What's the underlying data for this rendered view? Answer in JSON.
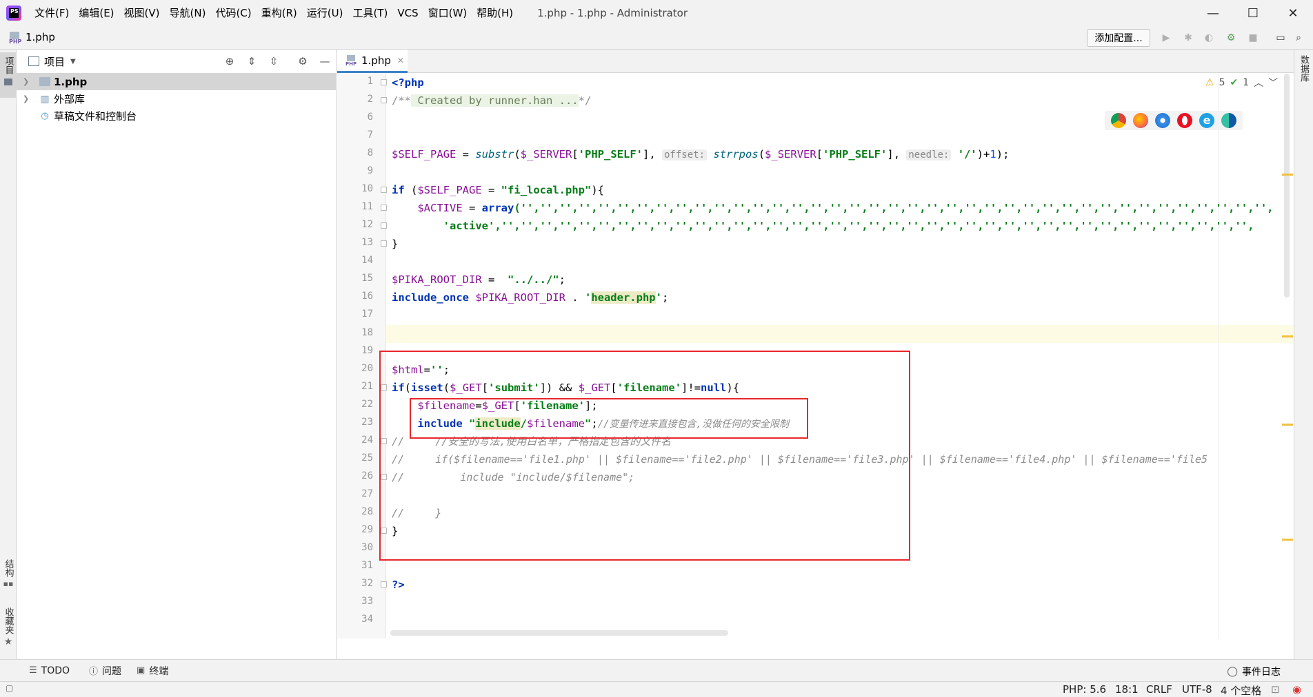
{
  "window": {
    "title": "1.php - 1.php - Administrator",
    "menu": [
      "文件(F)",
      "编辑(E)",
      "视图(V)",
      "导航(N)",
      "代码(C)",
      "重构(R)",
      "运行(U)",
      "工具(T)",
      "VCS",
      "窗口(W)",
      "帮助(H)"
    ],
    "minimize": "—",
    "maximize": "☐",
    "close": "✕"
  },
  "navbar": {
    "file_name": "1.php",
    "add_config": "添加配置..."
  },
  "left_strip": {
    "project": "项目",
    "structure": "结构",
    "favorites": "收藏夹"
  },
  "project_panel": {
    "title": "项目",
    "tree": [
      {
        "label": "1.php",
        "selected": true
      },
      {
        "label": "外部库",
        "selected": false
      },
      {
        "label": "草稿文件和控制台",
        "selected": false
      }
    ]
  },
  "editor": {
    "tab_label": "1.php",
    "tab_close": "✕",
    "warnings": "5",
    "checks": "1",
    "line_numbers": [
      "1",
      "2",
      "6",
      "7",
      "8",
      "9",
      "10",
      "11",
      "12",
      "13",
      "14",
      "15",
      "16",
      "17",
      "18",
      "19",
      "20",
      "21",
      "22",
      "23",
      "24",
      "25",
      "26",
      "27",
      "28",
      "29",
      "30",
      "31",
      "32",
      "33",
      "34"
    ],
    "code": {
      "l1": "<?php",
      "l2a": "/**",
      "l2b": " Created by runner.han ...",
      "l2c": "*/",
      "l8": {
        "var1": "$SELF_PAGE",
        "eq": " = ",
        "fn1": "substr",
        "p1": "(",
        "var2": "$_SERVER",
        "b1": "[",
        "s1": "'PHP_SELF'",
        "b2": "], ",
        "h1": "offset:",
        "fn2": "strrpos",
        "p2": "(",
        "var3": "$_SERVER",
        "b3": "[",
        "s2": "'PHP_SELF'",
        "b4": "], ",
        "h2": "needle:",
        "s3": "'/'",
        "end": ")+",
        "num": "1",
        "end2": ");"
      },
      "l10": {
        "kw": "if",
        "p": " (",
        "var": "$SELF_PAGE",
        "eq": " = ",
        "s": "\"fi_local.php\"",
        "end": "){"
      },
      "l11": {
        "indent": "    ",
        "var": "$ACTIVE",
        "eq": " = ",
        "kw": "array",
        "rest": "('','','','','','','','','','','','','','','','','','','','','','','','','','','','','','','','','','','','','','','',"
      },
      "l12": {
        "indent": "        ",
        "s": "'active'",
        "rest": ",'','','','','','','','','','','','','','','','','','','','','','','','','','','','','','','','','','','','','','','',"
      },
      "l13": "}",
      "l15": {
        "var": "$PIKA_ROOT_DIR",
        "eq": " =  ",
        "s": "\"../../\"",
        "end": ";"
      },
      "l16": {
        "kw": "include_once",
        "var": " $PIKA_ROOT_DIR",
        "dot": " . ",
        "q1": "'",
        "s": "header.php",
        "q2": "'",
        "end": ";"
      },
      "l20": {
        "var": "$html",
        "eq": "=",
        "s": "''",
        "end": ";"
      },
      "l21": {
        "kw1": "if",
        "p1": "(",
        "kw2": "isset",
        "p2": "(",
        "var1": "$_GET",
        "b1": "[",
        "s1": "'submit'",
        "b2": "]) && ",
        "var2": "$_GET",
        "b3": "[",
        "s2": "'filename'",
        "b4": "]!=",
        "kw3": "null",
        "end": "){"
      },
      "l22": {
        "indent": "    ",
        "var1": "$filename",
        "eq": "=",
        "var2": "$_GET",
        "b1": "[",
        "s": "'filename'",
        "end": "];"
      },
      "l23": {
        "indent": "    ",
        "kw": "include",
        "sp": " ",
        "q1": "\"",
        "s": "include",
        "slash": "/",
        "var": "$filename",
        "q2": "\"",
        "semi": ";",
        "cmt": "//变量传进来直接包含,没做任何的安全限制"
      },
      "l24": "//     //安全的写法,使用白名单，严格指定包含的文件名",
      "l25": "//     if($filename=='file1.php' || $filename=='file2.php' || $filename=='file3.php' || $filename=='file4.php' || $filename=='file5",
      "l26": "//         include \"include/$filename\";",
      "l28": "//     }",
      "l29": "}",
      "l32": "?>"
    }
  },
  "right_strip": {
    "database": "数据库"
  },
  "bottom_tools": {
    "todo": "TODO",
    "problems": "问题",
    "terminal": "终端",
    "event_log": "事件日志"
  },
  "status": {
    "php": "PHP: 5.6",
    "position": "18:1",
    "line_sep": "CRLF",
    "encoding": "UTF-8",
    "indent": "4 个空格"
  }
}
